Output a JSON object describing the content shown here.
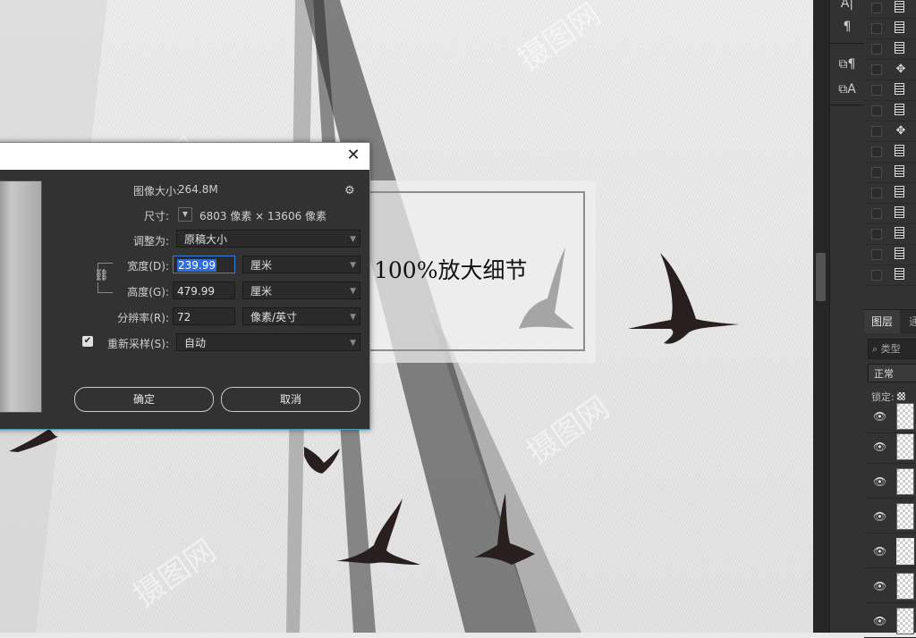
{
  "dialog": {
    "image_size_label": "图像大小:",
    "image_size_value": "264.8M",
    "dimensions_label": "尺寸:",
    "dimensions_value": "6803 像素 × 13606 像素",
    "fit_to_label": "调整为:",
    "fit_to_value": "原稿大小",
    "width_label": "宽度(D):",
    "width_value": "239.99",
    "width_unit": "厘米",
    "height_label": "高度(G):",
    "height_value": "479.99",
    "height_unit": "厘米",
    "resolution_label": "分辨率(R):",
    "resolution_value": "72",
    "resolution_unit": "像素/英寸",
    "resample_label": "重新采样(S):",
    "resample_checked": true,
    "resample_value": "自动",
    "ok_label": "确定",
    "cancel_label": "取消",
    "close_glyph": "✕"
  },
  "overlay": {
    "zoom_caption": "100%放大细节"
  },
  "layers_panel": {
    "tab_label": "图层",
    "tab2_label": "通",
    "filter_placeholder": "类型",
    "blend_mode": "正常",
    "lock_label": "锁定:"
  },
  "toolbar_icons": [
    "character-icon",
    "paragraph-icon",
    "paragraph-style-icon",
    "character-style-icon"
  ],
  "actions_list_icons": [
    "document",
    "document",
    "document",
    "move",
    "document",
    "document",
    "move",
    "document",
    "document",
    "document",
    "document",
    "document",
    "document",
    "document"
  ],
  "accent_color": "#4a9fb7"
}
